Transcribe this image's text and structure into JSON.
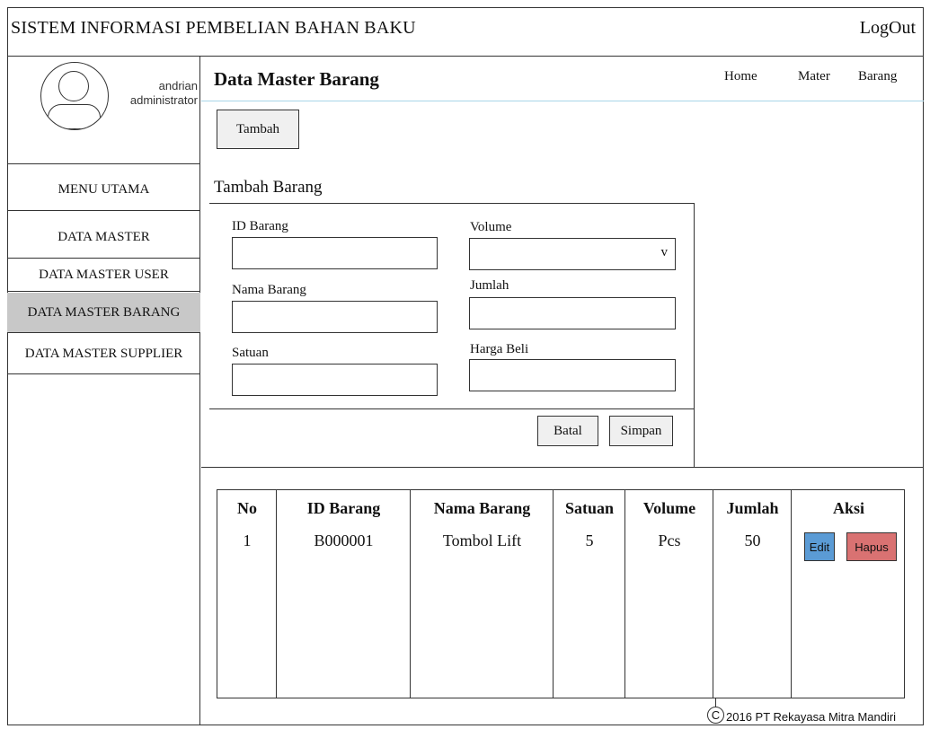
{
  "header": {
    "app_title": "SISTEM INFORMASI PEMBELIAN BAHAN BAKU",
    "logout_label": "LogOut"
  },
  "user": {
    "name": "andrian",
    "role": "administrator"
  },
  "sidebar": {
    "items": [
      {
        "label": "MENU UTAMA"
      },
      {
        "label": "DATA MASTER"
      },
      {
        "label": "DATA MASTER USER"
      },
      {
        "label": "DATA MASTER BARANG",
        "active": true
      },
      {
        "label": "DATA MASTER SUPPLIER"
      }
    ]
  },
  "main": {
    "page_title": "Data Master Barang",
    "breadcrumb": [
      "Home",
      "Mater",
      "Barang"
    ],
    "add_button_label": "Tambah"
  },
  "form": {
    "title": "Tambah Barang",
    "fields": {
      "id_barang": {
        "label": "ID Barang",
        "value": ""
      },
      "nama_barang": {
        "label": "Nama Barang",
        "value": ""
      },
      "satuan": {
        "label": "Satuan",
        "value": ""
      },
      "volume": {
        "label": "Volume",
        "value": "",
        "dropdown_glyph": "v"
      },
      "jumlah": {
        "label": "Jumlah",
        "value": ""
      },
      "harga_beli": {
        "label": "Harga Beli",
        "value": ""
      }
    },
    "cancel_label": "Batal",
    "save_label": "Simpan"
  },
  "table": {
    "columns": [
      "No",
      "ID Barang",
      "Nama Barang",
      "Satuan",
      "Volume",
      "Jumlah",
      "Aksi"
    ],
    "rows": [
      {
        "no": "1",
        "id_barang": "B000001",
        "nama_barang": "Tombol Lift",
        "satuan": "5",
        "volume": "Pcs",
        "jumlah": "50"
      }
    ],
    "edit_label": "Edit",
    "delete_label": "Hapus"
  },
  "footer": {
    "copyright_symbol": "C",
    "text": "2016 PT Rekayasa Mitra Mandiri"
  },
  "colors": {
    "active_menu": "#c8c8c8",
    "edit_button": "#5b9bd5",
    "delete_button": "#d97272",
    "header_rule": "#a9d6e8"
  }
}
